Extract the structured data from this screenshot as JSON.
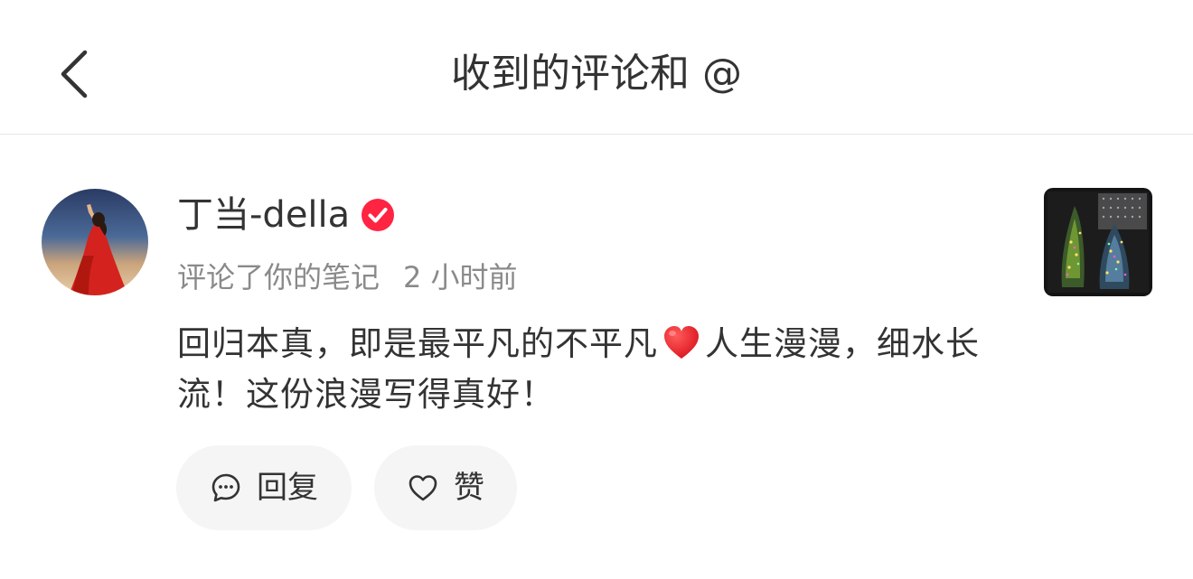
{
  "header": {
    "title": "收到的评论和 @",
    "back_icon": "chevron-left-icon"
  },
  "comment": {
    "username": "丁当-della",
    "verified_icon": "verified-badge-icon",
    "verified_color": "#ff2442",
    "action_text": "评论了你的笔记",
    "time_text": "2 小时前",
    "text_part1": "回归本真，即是最平凡的不平凡",
    "text_emoji": "red-heart-emoji",
    "text_part2": "人生漫漫，细水长流！这份浪漫写得真好！"
  },
  "actions": {
    "reply_label": "回复",
    "reply_icon": "comment-bubble-icon",
    "like_label": "赞",
    "like_icon": "heart-outline-icon"
  },
  "colors": {
    "text_primary": "#333333",
    "text_secondary": "#8a8a8a",
    "button_bg": "#f5f5f5",
    "divider": "#e6e6e6"
  }
}
